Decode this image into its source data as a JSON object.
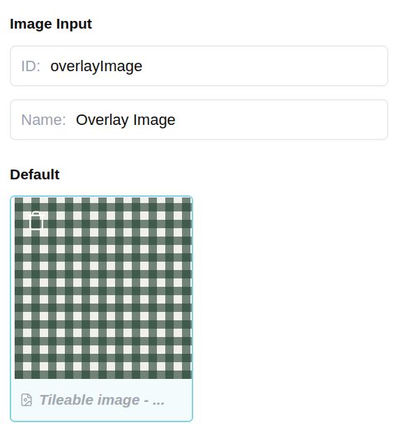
{
  "panel": {
    "title": "Image Input"
  },
  "fields": [
    {
      "label": "ID:",
      "value": "overlayImage"
    },
    {
      "label": "Name:",
      "value": "Overlay Image"
    }
  ],
  "default": {
    "heading": "Default",
    "image": {
      "caption": "Tileable image - ...",
      "selected": true
    }
  }
}
